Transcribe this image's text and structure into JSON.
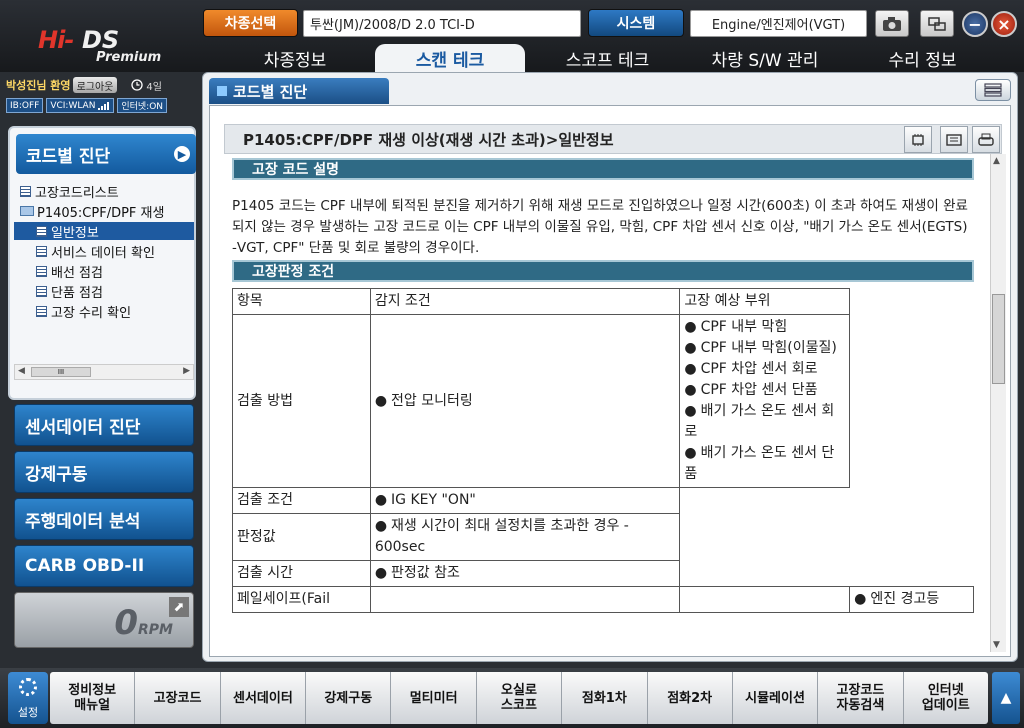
{
  "logo": {
    "hi": "Hi-",
    "ds": "DS",
    "premium": "Premium"
  },
  "header": {
    "model_button": "차종선택",
    "vehicle": "투싼(JM)/2008/D 2.0 TCI-D",
    "system_button": "시스템",
    "system": "Engine/엔진제어(VGT)"
  },
  "main_tabs": [
    "차종정보",
    "스캔 테크",
    "스코프 테크",
    "차량 S/W 관리",
    "수리 정보"
  ],
  "user": {
    "name": "박성진님 환영",
    "logout": "로그아웃",
    "days": "4일"
  },
  "status_badges": [
    "IB:OFF",
    "VCI:WLAN",
    "인터넷:ON"
  ],
  "tree": {
    "title": "코드별 진단",
    "items": [
      "고장코드리스트",
      "P1405:CPF/DPF 재생",
      "일반정보",
      "서비스 데이터 확인",
      "배선 점검",
      "단품 점검",
      "고장 수리 확인"
    ],
    "scroll_thumb": "III"
  },
  "left_menu": [
    "센서데이터 진단",
    "강제구동",
    "주행데이터 분석",
    "CARB OBD-II"
  ],
  "rpm": {
    "value": "0",
    "unit": "RPM"
  },
  "content": {
    "tab": "코드별 진단",
    "doc_title": "P1405:CPF/DPF 재생 이상(재생 시간 초과)>일반정보",
    "section1": "고장 코드 설명",
    "description": "P1405 코드는 CPF 내부에 퇴적된 분진을 제거하기 위해 재생 모드로 진입하였으나 일정 시간(600초) 이 초과 하여도 재생이 완료 되지 않는 경우 발생하는 고장 코드로 이는 CPF 내부의 이물질 유입, 막힘, CPF 차압 센서 신호 이상, \"배기 가스 온도 센서(EGTS) -VGT, CPF\" 단품 및 회로 불량의 경우이다.",
    "section2": "고장판정 조건",
    "table": {
      "headers": [
        "항목",
        "감지 조건",
        "고장 예상 부위"
      ],
      "detect_method": "검출 방법",
      "detect_method_value": "전압 모니터링",
      "causes": [
        "CPF 내부 막힘",
        "CPF 내부 막힘(이물질)",
        "CPF 차압 센서 회로",
        "CPF 차압 센서 단품",
        "배기 가스 온도 센서 회로",
        "배기 가스 온도 센서 단품"
      ],
      "detect_condition": "검출 조건",
      "detect_condition_value": "IG KEY \"ON\"",
      "judgement": "판정값",
      "judgement_value": "재생 시간이 최대 설정치를 초과한 경우 - 600sec",
      "detect_time": "검출 시간",
      "detect_time_value": "판정값 참조",
      "failsafe": "페일세이프(Fail",
      "failsafe_value": "엔진 경고등"
    }
  },
  "bottom": {
    "settings": "설정",
    "items": [
      "정비정보\n매뉴얼",
      "고장코드",
      "센서데이터",
      "강제구동",
      "멀티미터",
      "오실로\n스코프",
      "점화1차",
      "점화2차",
      "시뮬레이션",
      "고장코드\n자동검색",
      "인터넷\n업데이트"
    ]
  },
  "colors": {
    "accent_blue": "#1e5aa0",
    "orange": "#e07a22",
    "section_bar": "#2f6a85"
  }
}
